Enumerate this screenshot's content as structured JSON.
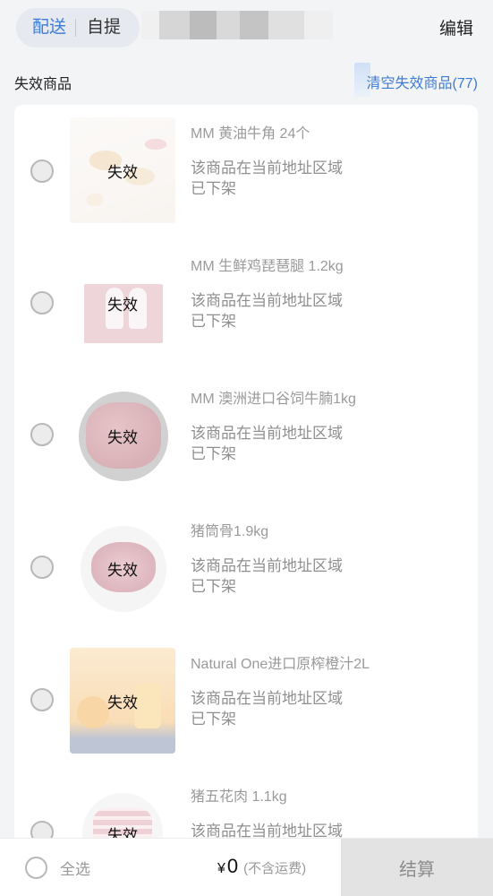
{
  "header": {
    "modes": [
      "配送",
      "自提"
    ],
    "active_mode": "配送",
    "edit_label": "编辑"
  },
  "section": {
    "title": "失效商品",
    "clear_label": "清空失效商品(77)"
  },
  "invalid_badge": "失效",
  "items": [
    {
      "name": "MM 黄油牛角 24个",
      "note_line1": "该商品在当前地址区域",
      "note_line2": "已下架",
      "image": "croissant-image"
    },
    {
      "name": "MM 生鲜鸡琵琶腿 1.2kg",
      "note_line1": "该商品在当前地址区域",
      "note_line2": "已下架",
      "image": "chicken-drumstick-package-image"
    },
    {
      "name": "MM 澳洲进口谷饲牛腩1kg",
      "note_line1": "该商品在当前地址区域",
      "note_line2": "已下架",
      "image": "beef-brisket-plate-image"
    },
    {
      "name": "猪筒骨1.9kg",
      "note_line1": "该商品在当前地址区域",
      "note_line2": "已下架",
      "image": "pork-bone-plate-image"
    },
    {
      "name": "Natural One进口原榨橙汁2L",
      "note_line1": "该商品在当前地址区域",
      "note_line2": "已下架",
      "image": "orange-juice-promo-image"
    },
    {
      "name": "猪五花肉 1.1kg",
      "note_line1": "该商品在当前地址区域",
      "note_line2": "",
      "image": "pork-belly-plate-image"
    }
  ],
  "footer": {
    "select_all_label": "全选",
    "currency_symbol": "¥",
    "total": "0",
    "total_note": "(不含运费)",
    "checkout_label": "结算"
  },
  "colors": {
    "accent": "#3d7bd6",
    "background": "#f3f4f6",
    "card": "#ffffff",
    "muted_text": "#9a9a9a",
    "checkout_disabled": "#e3e3e3"
  }
}
